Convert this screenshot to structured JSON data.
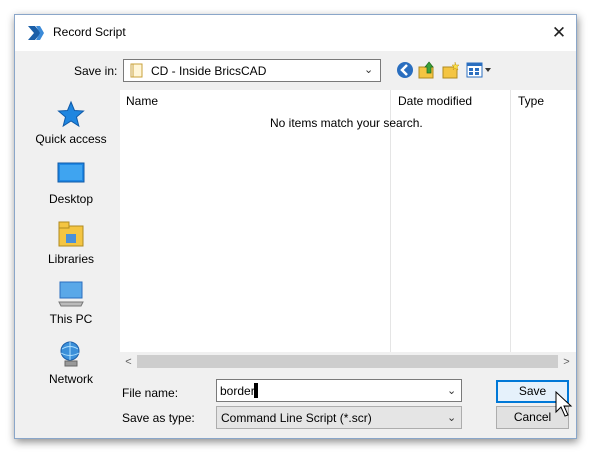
{
  "window": {
    "title": "Record Script"
  },
  "toolbar": {
    "save_in_label": "Save in:",
    "save_in_value": "CD - Inside BricsCAD"
  },
  "places": [
    {
      "label": "Quick access",
      "icon": "star-icon"
    },
    {
      "label": "Desktop",
      "icon": "desktop-icon"
    },
    {
      "label": "Libraries",
      "icon": "libraries-icon"
    },
    {
      "label": "This PC",
      "icon": "computer-icon"
    },
    {
      "label": "Network",
      "icon": "network-icon"
    }
  ],
  "file_list": {
    "columns": [
      "Name",
      "Date modified",
      "Type"
    ],
    "empty_message": "No items match your search."
  },
  "form": {
    "file_name_label": "File name:",
    "file_name_value": "border",
    "save_type_label": "Save as type:",
    "save_type_value": "Command Line Script (*.scr)"
  },
  "buttons": {
    "save": "Save",
    "cancel": "Cancel"
  },
  "colors": {
    "accent": "#0078d7",
    "window_bg": "#f0f0f0"
  }
}
